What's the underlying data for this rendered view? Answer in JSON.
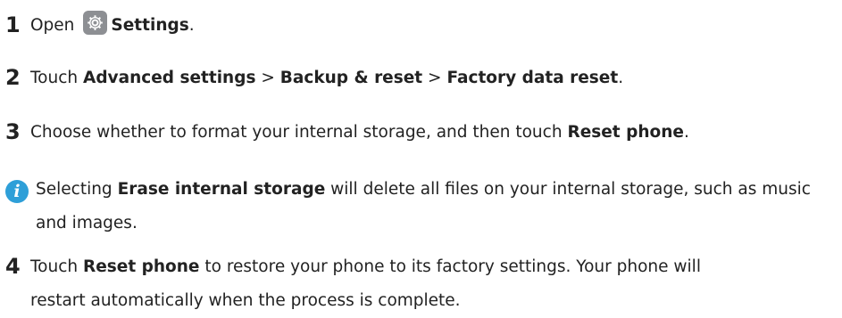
{
  "steps": [
    {
      "number": "1",
      "t1": "Open",
      "b1": "Settings",
      "t2": "."
    },
    {
      "number": "2",
      "t1": "Touch",
      "b1": "Advanced settings",
      "sep1": ">",
      "b2": "Backup & reset",
      "sep2": ">",
      "b3": "Factory data reset",
      "t2": "."
    },
    {
      "number": "3",
      "t1": "Choose whether to format your internal storage, and then touch",
      "b1": "Reset phone",
      "t2": "."
    },
    {
      "number": "4",
      "t1": "Touch",
      "b1": "Reset phone",
      "t2": "to restore your phone to its factory settings. Your phone will",
      "t3": "restart automatically when the process is complete."
    }
  ],
  "note": {
    "icon_letter": "i",
    "t1": "Selecting",
    "b1": "Erase internal storage",
    "t2": "will delete all files on your internal storage, such as music and images."
  },
  "icons": {
    "settings": "gear-icon",
    "info": "info-icon"
  },
  "colors": {
    "info_icon": "#2e9fd8",
    "settings_icon_bg": "#8d8f93"
  }
}
